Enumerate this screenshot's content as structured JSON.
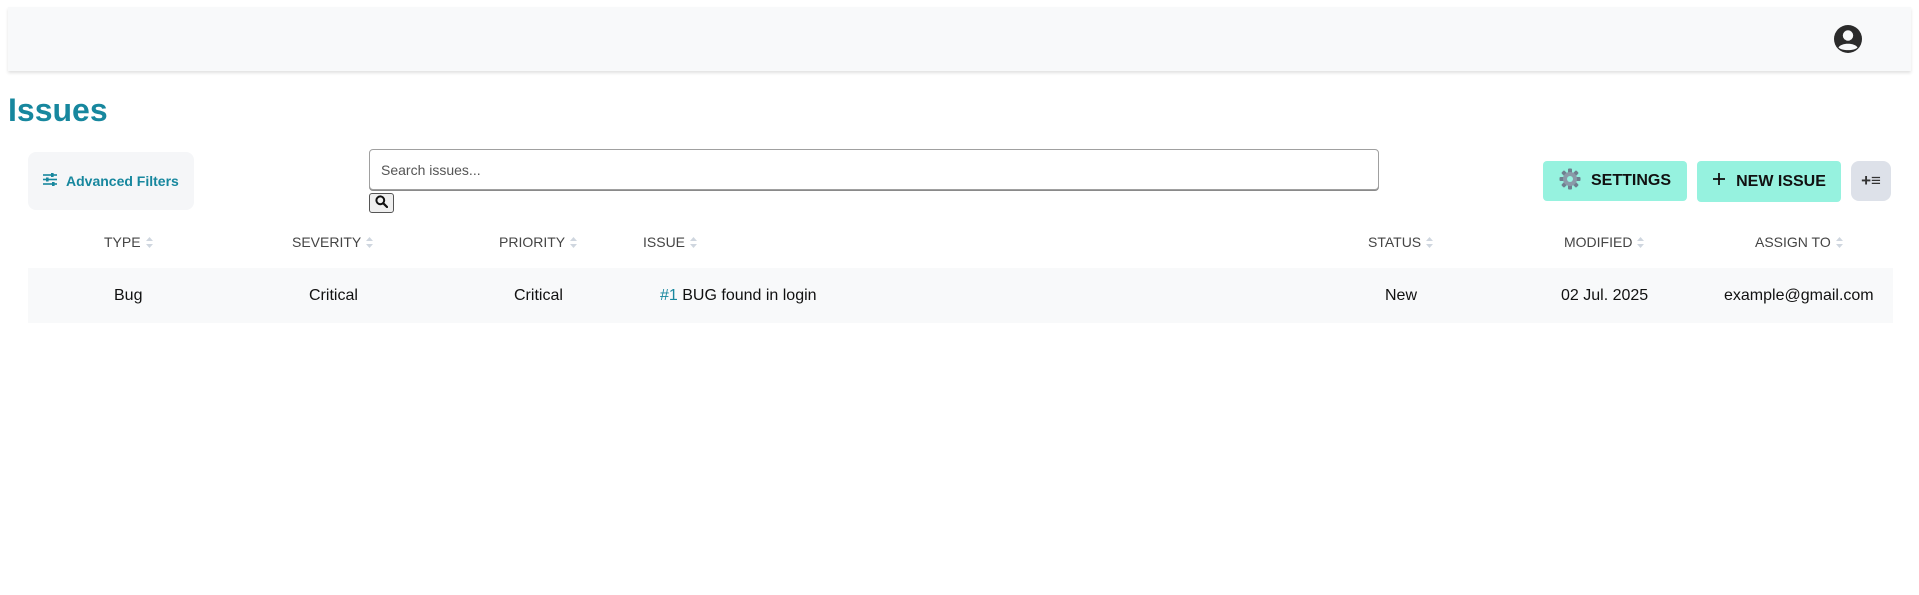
{
  "page": {
    "title": "Issues"
  },
  "toolbar": {
    "advanced_filters_label": "Advanced Filters",
    "search_placeholder": "Search issues...",
    "search_value": "",
    "settings_label": "SETTINGS",
    "new_issue_label": "NEW ISSUE",
    "columns_button_label": "+≡"
  },
  "table": {
    "headers": [
      "TYPE",
      "SEVERITY",
      "PRIORITY",
      "ISSUE",
      "STATUS",
      "MODIFIED",
      "ASSIGN TO"
    ],
    "rows": [
      {
        "type": "Bug",
        "severity": "Critical",
        "priority": "Critical",
        "issue_number": "#1",
        "issue_title": "BUG found in login",
        "status": "New",
        "modified": "02 Jul. 2025",
        "assign_to": "example@gmail.com"
      }
    ]
  },
  "colors": {
    "accent": "#17879e",
    "button_bg": "#96f2df",
    "topbar_bg": "#f8f9fa"
  },
  "icons": {
    "user": "user-circle-icon",
    "filters": "sliders-icon",
    "search": "magnifier-icon",
    "settings": "gear-icon",
    "new_issue": "plus-icon"
  }
}
